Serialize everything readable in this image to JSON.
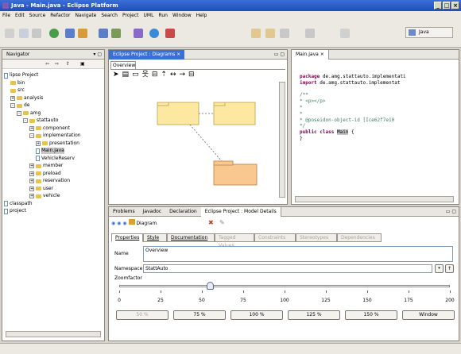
{
  "window": {
    "title": "Java - Main.java - Eclipse Platform"
  },
  "menu": [
    "File",
    "Edit",
    "Source",
    "Refactor",
    "Navigate",
    "Search",
    "Project",
    "UML",
    "Run",
    "Window",
    "Help"
  ],
  "perspective": {
    "label": "Java"
  },
  "navigator": {
    "tab": "Navigator",
    "items": [
      {
        "label": "lipse Project",
        "indent": 0,
        "icon": "project-icon",
        "toggle": ""
      },
      {
        "label": "bin",
        "indent": 1,
        "icon": "folder-icon",
        "toggle": ""
      },
      {
        "label": "src",
        "indent": 1,
        "icon": "folder-icon",
        "toggle": ""
      },
      {
        "label": "analysis",
        "indent": 1,
        "icon": "folder-icon",
        "toggle": "+"
      },
      {
        "label": "de",
        "indent": 1,
        "icon": "folder-icon",
        "toggle": "-"
      },
      {
        "label": "amg",
        "indent": 2,
        "icon": "folder-icon",
        "toggle": "-"
      },
      {
        "label": "stattauto",
        "indent": 3,
        "icon": "folder-icon",
        "toggle": "-"
      },
      {
        "label": "component",
        "indent": 4,
        "icon": "folder-icon",
        "toggle": "+"
      },
      {
        "label": "implementation",
        "indent": 4,
        "icon": "folder-icon",
        "toggle": "-"
      },
      {
        "label": "presentation",
        "indent": 5,
        "icon": "folder-icon",
        "toggle": "+"
      },
      {
        "label": "Main.java",
        "indent": 5,
        "icon": "java-file-icon",
        "toggle": "",
        "selected": true
      },
      {
        "label": "VehicleReserv",
        "indent": 5,
        "icon": "java-file-icon",
        "toggle": ""
      },
      {
        "label": "member",
        "indent": 4,
        "icon": "folder-icon",
        "toggle": "+"
      },
      {
        "label": "preload",
        "indent": 4,
        "icon": "folder-icon",
        "toggle": "+"
      },
      {
        "label": "reservation",
        "indent": 4,
        "icon": "folder-icon",
        "toggle": "+"
      },
      {
        "label": "user",
        "indent": 4,
        "icon": "folder-icon",
        "toggle": "+"
      },
      {
        "label": "vehicle",
        "indent": 4,
        "icon": "folder-icon",
        "toggle": "+"
      },
      {
        "label": "classpath",
        "indent": 0,
        "icon": "file-icon",
        "toggle": ""
      },
      {
        "label": "project",
        "indent": 0,
        "icon": "file-icon",
        "toggle": ""
      }
    ]
  },
  "diagram": {
    "tab": "Eclipse Project : Diagrams",
    "subtab": "Overview"
  },
  "editor": {
    "tab": "Main.java",
    "lines": [
      {
        "kw": "package",
        "text": " de.amg.stattauto.implementati"
      },
      {
        "kw": "import",
        "text": " de.amg.stattauto.implementat"
      },
      {
        "kw": "",
        "text": ""
      },
      {
        "cmt": "/**"
      },
      {
        "cmt": " * <p></p>"
      },
      {
        "cmt": " *"
      },
      {
        "cmt": " *"
      },
      {
        "cmt": " * @poseidon-object-id [Ice62f7e10"
      },
      {
        "cmt": " */"
      },
      {
        "kw": "public class",
        "hl": "Main",
        "text": " {"
      },
      {
        "kw": "",
        "text": "}"
      }
    ]
  },
  "bottom": {
    "tabs": [
      "Problems",
      "Javadoc",
      "Declaration",
      "Eclipse Project : Model Details"
    ],
    "header": "Diagram",
    "subtabs": [
      {
        "label": "Properties",
        "state": "normal"
      },
      {
        "label": "Style",
        "state": "normal"
      },
      {
        "label": "Documentation",
        "state": "normal"
      },
      {
        "label": "Tagged Values",
        "state": "disabled"
      },
      {
        "label": "Constraints",
        "state": "disabled"
      },
      {
        "label": "Stereotypes",
        "state": "disabled"
      },
      {
        "label": "Dependencies",
        "state": "disabled"
      }
    ],
    "name_label": "Name",
    "name_value": "Overview",
    "namespace_label": "Namespace",
    "namespace_value": "StattAuto",
    "zoom_label": "Zoomfactor",
    "zoom_value": 55,
    "ticks": [
      "0",
      "25",
      "50",
      "75",
      "100",
      "125",
      "150",
      "175",
      "200"
    ],
    "zoom_buttons": [
      {
        "label": "50 %",
        "disabled": true
      },
      {
        "label": "75 %",
        "disabled": false
      },
      {
        "label": "100 %",
        "disabled": false
      },
      {
        "label": "125 %",
        "disabled": false
      },
      {
        "label": "150 %",
        "disabled": false
      },
      {
        "label": "Window",
        "disabled": false
      }
    ]
  }
}
